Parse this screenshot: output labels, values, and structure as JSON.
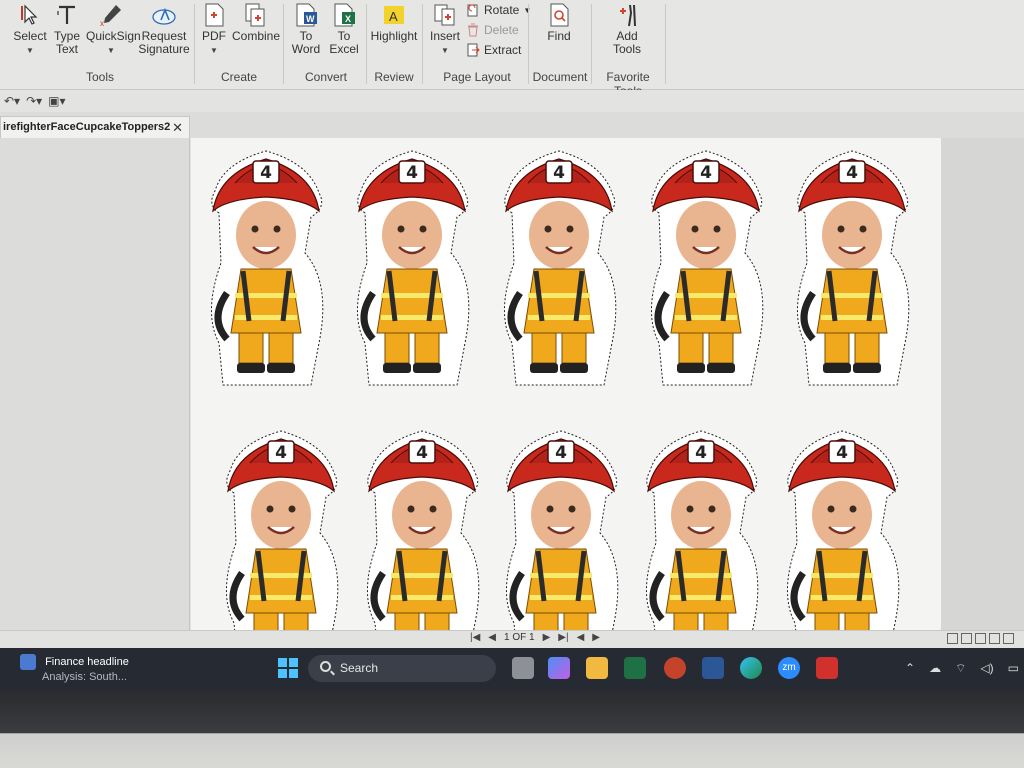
{
  "ribbon": {
    "tools": {
      "select": "Select",
      "type_text": "Type Text",
      "quicksign": "QuickSign",
      "request_signature": "Request Signature",
      "pdf": "PDF",
      "combine": "Combine",
      "to_word": "To Word",
      "to_excel": "To Excel",
      "highlight": "Highlight",
      "insert": "Insert",
      "rotate": "Rotate",
      "delete": "Delete",
      "extract": "Extract",
      "find": "Find",
      "add_tools": "Add Tools"
    },
    "groups": {
      "tools": "Tools",
      "create": "Create",
      "convert": "Convert",
      "review": "Review",
      "page_layout": "Page Layout",
      "document": "Document",
      "favorite_tools": "Favorite Tools"
    }
  },
  "tab": {
    "title": "irefighterFaceCupcakeToppers2",
    "close": "✕"
  },
  "document": {
    "helmet_number": "4"
  },
  "statusbar": {
    "page_indicator": "1 OF 1"
  },
  "taskbar": {
    "news_title": "Finance headline",
    "news_sub": "Analysis: South...",
    "search_placeholder": "Search",
    "zoom_label": "zm"
  },
  "colors": {
    "helmet": "#c9281d",
    "coat": "#f0a81c",
    "taskbar": "#262a33",
    "accent_blue": "#4cc2ff"
  }
}
